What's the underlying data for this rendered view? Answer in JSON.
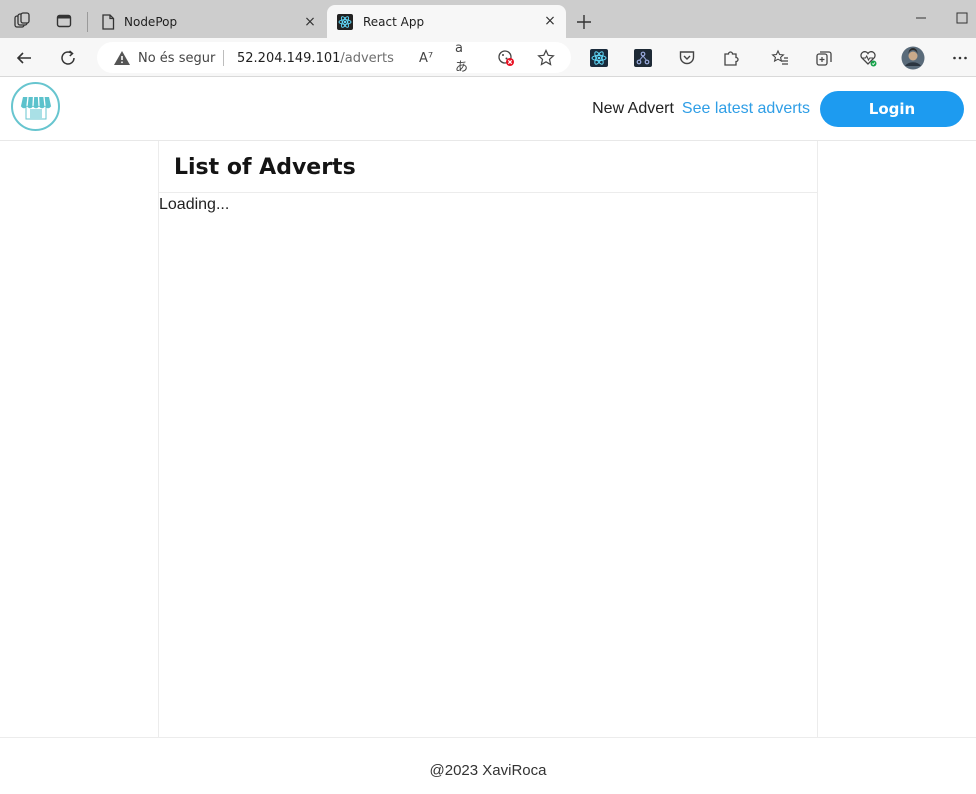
{
  "browser": {
    "tabs": [
      {
        "title": "NodePop",
        "active": false,
        "icon": "page-icon"
      },
      {
        "title": "React App",
        "active": true,
        "icon": "react-icon"
      }
    ],
    "close_glyph": "×",
    "address": {
      "security_text": "No és segur",
      "url_host": "52.204.149.101",
      "url_path": "/adverts",
      "read_aloud_glyph": "A⁷",
      "translate_glyph": "aあ"
    },
    "profile_color": "#5a6b7a"
  },
  "app": {
    "nav": {
      "new_advert": "New Advert",
      "latest_adverts": "See latest adverts",
      "login": "Login"
    },
    "logo_icon": "store-awning-icon",
    "accent_color": "#1d9bf0",
    "link_color": "#2f9ee6"
  },
  "main": {
    "title": "List of Adverts",
    "status": "Loading..."
  },
  "footer": {
    "text": "@2023 XaviRoca"
  }
}
